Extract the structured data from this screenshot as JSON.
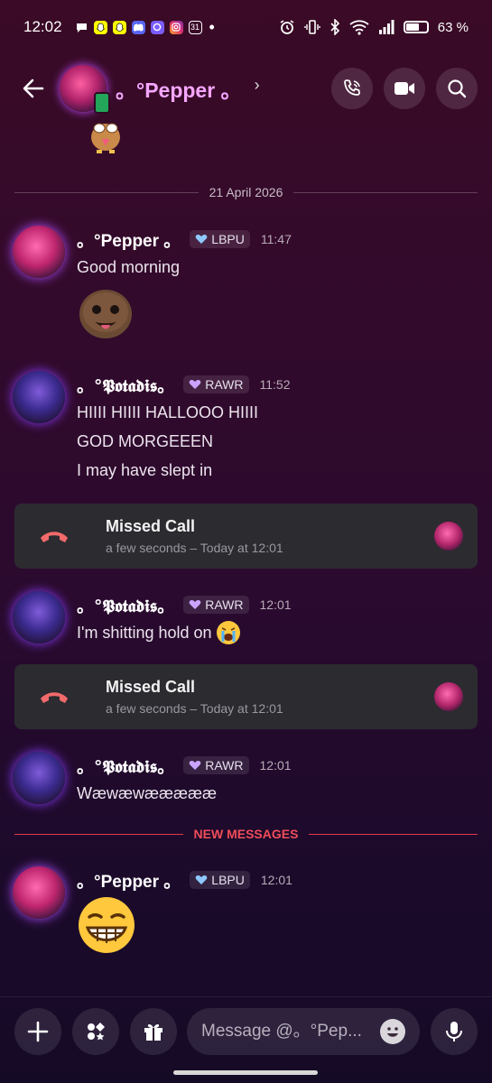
{
  "status_bar": {
    "time": "12:02",
    "battery": "63 %",
    "battery_level": 0.63
  },
  "header": {
    "contact_name": "。°Pepper 。",
    "call_label": "voice-call",
    "video_label": "video-call",
    "search_label": "search"
  },
  "date_divider": "21 April 2026",
  "messages": [
    {
      "author": "。°Pepper 。",
      "tag": "LBPU",
      "time": "11:47",
      "lines": [
        "Good morning"
      ]
    },
    {
      "author": "。°𝕻𝖔𝖙𝖆𝖉𝖎𝖘。",
      "tag": "RAWR",
      "time": "11:52",
      "lines": [
        "HIIII HIIII HALLOOO HIIII",
        "GOD MORGEEEN",
        "I may have slept in"
      ]
    },
    {
      "author": "。°𝕻𝖔𝖙𝖆𝖉𝖎𝖘。",
      "tag": "RAWR",
      "time": "12:01",
      "lines": [
        "I'm shitting hold on"
      ]
    },
    {
      "author": "。°𝕻𝖔𝖙𝖆𝖉𝖎𝖘。",
      "tag": "RAWR",
      "time": "12:01",
      "lines": [
        "Wæwæwæææææ"
      ]
    },
    {
      "author": "。°Pepper 。",
      "tag": "LBPU",
      "time": "12:01",
      "lines": []
    }
  ],
  "calls": [
    {
      "title": "Missed Call",
      "subtitle": "a few seconds – Today at 12:01"
    },
    {
      "title": "Missed Call",
      "subtitle": "a few seconds – Today at 12:01"
    }
  ],
  "new_messages_divider": "NEW MESSAGES",
  "composer": {
    "placeholder": "Message @。°Pep..."
  },
  "colors": {
    "accent_name": "#f5a6ff",
    "new_messages": "#f04d5a",
    "missed_call": "#f26a6a",
    "online": "#23a55a"
  }
}
